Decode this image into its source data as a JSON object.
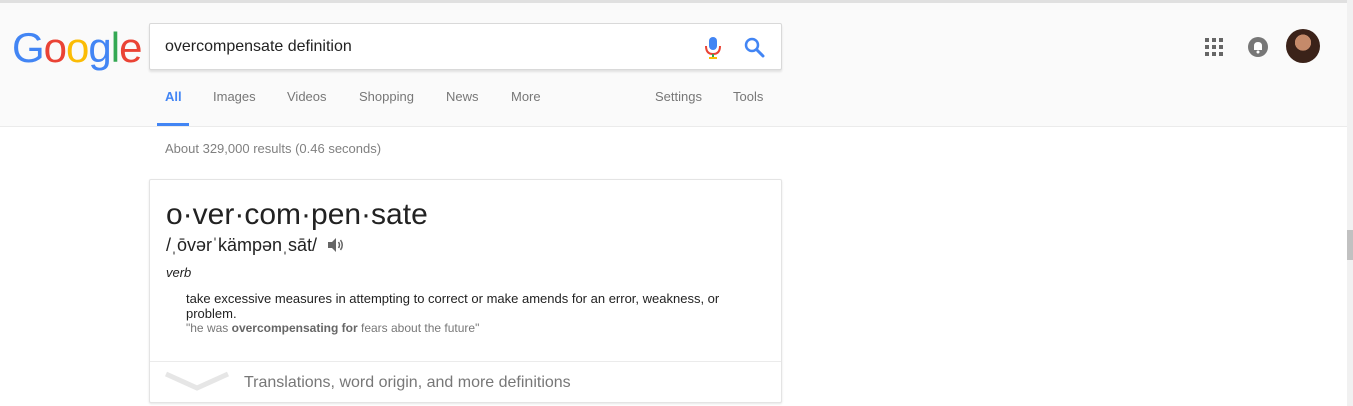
{
  "logo": {
    "letters": [
      "G",
      "o",
      "o",
      "g",
      "l",
      "e"
    ],
    "colors": [
      "#4285f4",
      "#ea4335",
      "#fbbc05",
      "#4285f4",
      "#34a853",
      "#ea4335"
    ]
  },
  "search": {
    "query": "overcompensate definition",
    "mic_icon": "microphone-icon",
    "search_icon": "search-icon"
  },
  "header_icons": {
    "apps": "apps-grid-icon",
    "notifications": "bell-icon",
    "avatar": "user-avatar"
  },
  "tabs": [
    "All",
    "Images",
    "Videos",
    "Shopping",
    "News",
    "More"
  ],
  "tools": [
    "Settings",
    "Tools"
  ],
  "stats": "About 329,000 results (0.46 seconds)",
  "definition": {
    "word": "o·ver·com·pen·sate",
    "pronunciation": "/ˌōvərˈkämpənˌsāt/",
    "part_of_speech": "verb",
    "text": "take excessive measures in attempting to correct or make amends for an error, weakness, or problem.",
    "example_prefix": "\"he was ",
    "example_bold": "overcompensating for",
    "example_suffix": " fears about the future\"",
    "more_label": "Translations, word origin, and more definitions"
  },
  "colors": {
    "accent": "#4285f4",
    "mic_blue": "#4285f4",
    "mic_red": "#ea4335"
  }
}
